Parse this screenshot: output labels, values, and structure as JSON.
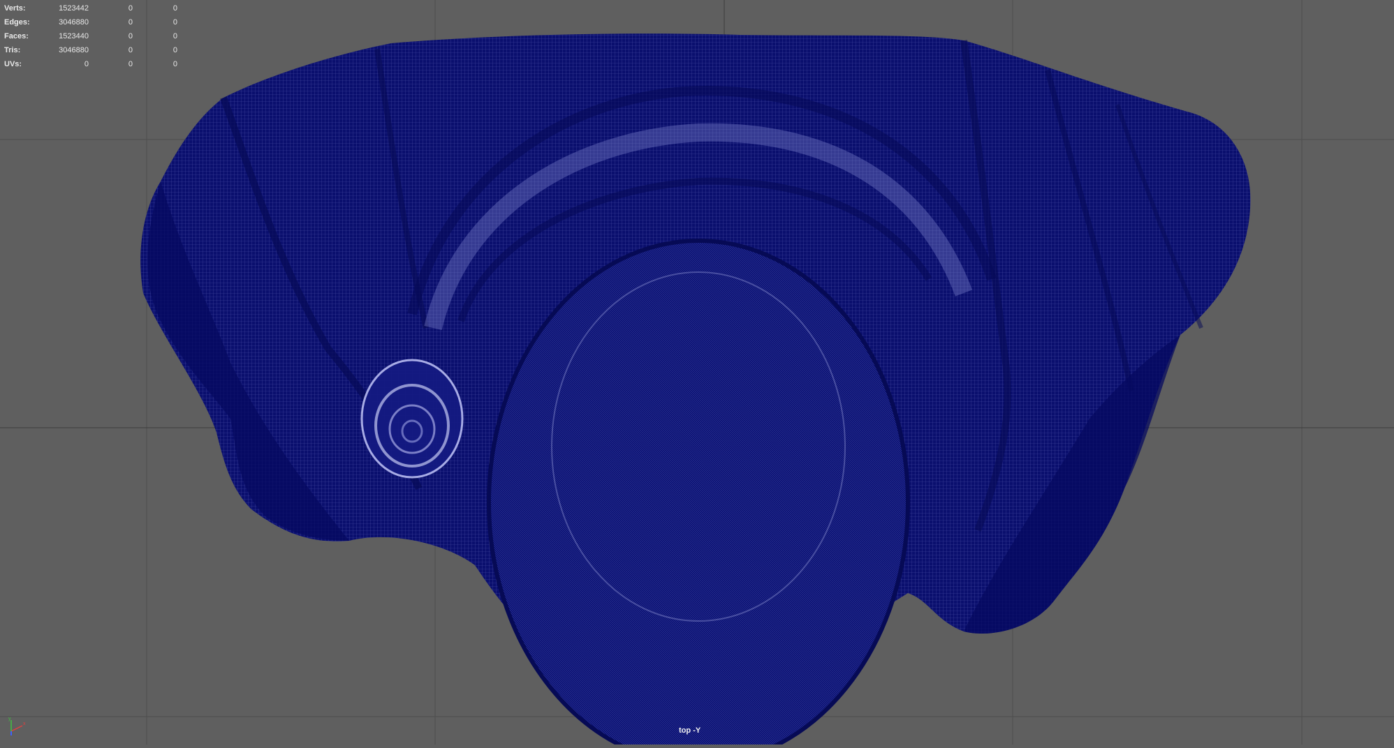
{
  "hud": {
    "rows": [
      {
        "label": "Verts:",
        "c1": "1523442",
        "c2": "0",
        "c3": "0"
      },
      {
        "label": "Edges:",
        "c1": "3046880",
        "c2": "0",
        "c3": "0"
      },
      {
        "label": "Faces:",
        "c1": "1523440",
        "c2": "0",
        "c3": "0"
      },
      {
        "label": "Tris:",
        "c1": "3046880",
        "c2": "0",
        "c3": "0"
      },
      {
        "label": "UVs:",
        "c1": "0",
        "c2": "0",
        "c3": "0"
      }
    ]
  },
  "camera": {
    "label": "top -Y"
  },
  "colors": {
    "background": "#5f5f5f",
    "grid": "#4a4a4a",
    "mesh": "#0a0f6e",
    "wire": "#8f94d8"
  },
  "icons": {
    "axis_gizmo": "xyz-axis-icon"
  }
}
